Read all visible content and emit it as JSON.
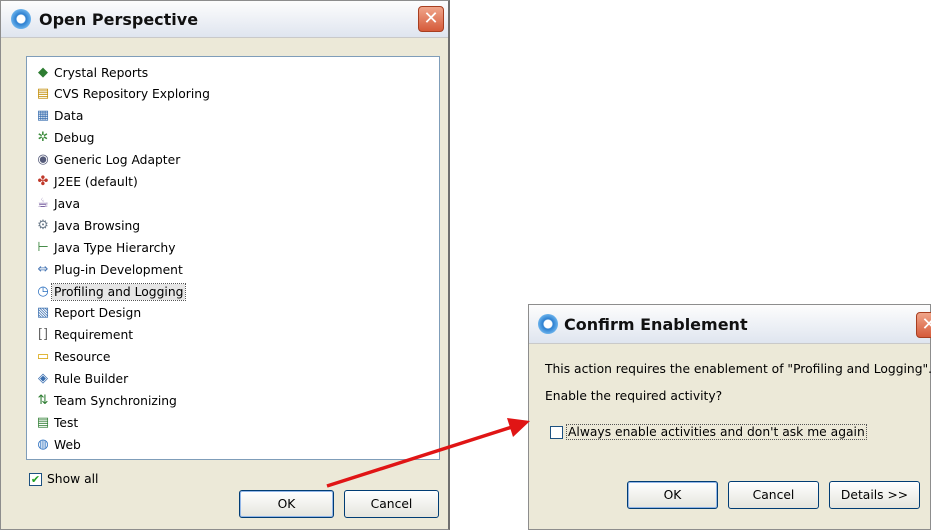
{
  "open_perspective": {
    "title": "Open Perspective",
    "close_icon": "close-icon",
    "items": [
      {
        "label": "Crystal Reports",
        "icon": "crystal-reports-icon",
        "glyph": "◆",
        "color": "#2e7d32"
      },
      {
        "label": "CVS Repository Exploring",
        "icon": "cvs-repository-icon",
        "glyph": "▤",
        "color": "#c08a00"
      },
      {
        "label": "Data",
        "icon": "data-icon",
        "glyph": "▦",
        "color": "#3a6fb0"
      },
      {
        "label": "Debug",
        "icon": "debug-icon",
        "glyph": "✲",
        "color": "#3c8c3c"
      },
      {
        "label": "Generic Log Adapter",
        "icon": "log-adapter-icon",
        "glyph": "◉",
        "color": "#555b7a"
      },
      {
        "label": "J2EE (default)",
        "icon": "j2ee-icon",
        "glyph": "✤",
        "color": "#c0392b"
      },
      {
        "label": "Java",
        "icon": "java-icon",
        "glyph": "☕",
        "color": "#5a3a8a"
      },
      {
        "label": "Java Browsing",
        "icon": "java-browsing-icon",
        "glyph": "⚙",
        "color": "#6b7a8a"
      },
      {
        "label": "Java Type Hierarchy",
        "icon": "type-hierarchy-icon",
        "glyph": "⊢",
        "color": "#2e7d32"
      },
      {
        "label": "Plug-in Development",
        "icon": "plugin-icon",
        "glyph": "⇔",
        "color": "#4a78b5"
      },
      {
        "label": "Profiling and Logging",
        "icon": "profiling-icon",
        "glyph": "◷",
        "color": "#2a6fbf",
        "selected": true
      },
      {
        "label": "Report Design",
        "icon": "report-design-icon",
        "glyph": "▧",
        "color": "#3a6fb0"
      },
      {
        "label": "Requirement",
        "icon": "requirement-icon",
        "glyph": "[]",
        "color": "#666666"
      },
      {
        "label": "Resource",
        "icon": "resource-icon",
        "glyph": "▭",
        "color": "#d6a100"
      },
      {
        "label": "Rule Builder",
        "icon": "rule-builder-icon",
        "glyph": "◈",
        "color": "#3a6fb0"
      },
      {
        "label": "Team Synchronizing",
        "icon": "team-sync-icon",
        "glyph": "⇅",
        "color": "#2e7d32"
      },
      {
        "label": "Test",
        "icon": "test-icon",
        "glyph": "▤",
        "color": "#2e7d32"
      },
      {
        "label": "Web",
        "icon": "web-icon",
        "glyph": "◍",
        "color": "#2a6fbf"
      }
    ],
    "show_all_label": "Show all",
    "show_all_checked_mark": "✔",
    "ok_label": "OK",
    "cancel_label": "Cancel"
  },
  "confirm_enablement": {
    "title": "Confirm Enablement",
    "message": "This action requires the enablement of \"Profiling and Logging\".",
    "question": "Enable the required activity?",
    "always_enable_label": "Always enable activities and don't ask me again",
    "ok_label": "OK",
    "cancel_label": "Cancel",
    "details_label": "Details >>"
  },
  "colors": {
    "dialog_bg": "#ece9d8",
    "arrow": "#e01515",
    "close_button": "#d55a3a"
  }
}
